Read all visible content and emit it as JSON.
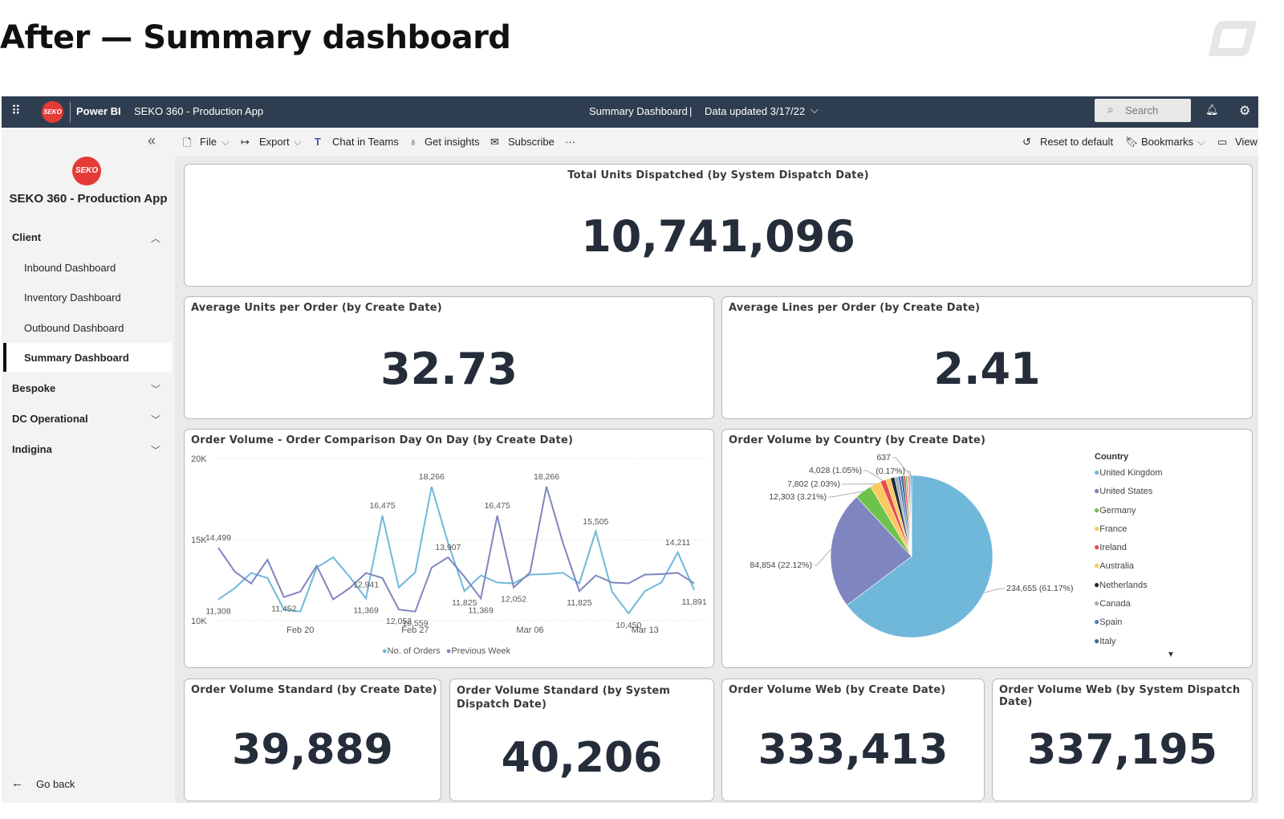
{
  "page_heading": "After — Summary dashboard",
  "topbar": {
    "app_name": "Power BI",
    "workspace": "SEKO 360 - Production App",
    "report_name": "Summary Dashboard",
    "separator": "|",
    "data_updated": "Data updated 3/17/22",
    "search_placeholder": "Search",
    "logo_text": "SEKO"
  },
  "toolbar": {
    "file": "File",
    "export": "Export",
    "chat_in_teams": "Chat in Teams",
    "get_insights": "Get insights",
    "subscribe": "Subscribe",
    "more": "···",
    "reset": "Reset to default",
    "bookmarks": "Bookmarks",
    "view": "View"
  },
  "sidebar": {
    "app_title": "SEKO 360 - Production App",
    "sections": [
      {
        "label": "Client",
        "expanded": true,
        "items": [
          "Inbound Dashboard",
          "Inventory Dashboard",
          "Outbound Dashboard",
          "Summary Dashboard"
        ],
        "active": "Summary Dashboard"
      },
      {
        "label": "Bespoke",
        "expanded": false
      },
      {
        "label": "DC Operational",
        "expanded": false
      },
      {
        "label": "Indigina",
        "expanded": false
      }
    ],
    "go_back": "Go back"
  },
  "cards": {
    "total_units": {
      "title": "Total Units Dispatched (by System Dispatch Date)",
      "value": "10,741,096"
    },
    "avg_units": {
      "title": "Average Units per Order (by Create Date)",
      "value": "32.73"
    },
    "avg_lines": {
      "title": "Average Lines per Order (by Create Date)",
      "value": "2.41"
    },
    "ov_standard_create": {
      "title": "Order Volume Standard (by Create Date)",
      "value": "39,889"
    },
    "ov_standard_dispatch": {
      "title": "Order Volume Standard (by System Dispatch Date)",
      "value": "40,206"
    },
    "ov_web_create": {
      "title": "Order Volume Web (by Create Date)",
      "value": "333,413"
    },
    "ov_web_dispatch": {
      "title": "Order Volume Web (by System Dispatch Date)",
      "value": "337,195"
    }
  },
  "chart_data": [
    {
      "type": "line",
      "title": "Order Volume - Order Comparison Day On Day (by Create Date)",
      "x_start": "2022-02-15",
      "x_ticks": [
        "Feb 20",
        "Feb 27",
        "Mar 06",
        "Mar 13"
      ],
      "y_ticks": [
        "10K",
        "15K",
        "20K"
      ],
      "ylim": [
        10000,
        20000
      ],
      "grid": true,
      "legend": "bottom",
      "series": [
        {
          "name": "No. of Orders",
          "color": "#6fb8da",
          "values": [
            11308,
            12000,
            12941,
            12630,
            10690,
            10559,
            13270,
            13907,
            12710,
            11369,
            16475,
            12052,
            12980,
            18266,
            14800,
            11825,
            12790,
            12350,
            12300,
            12840,
            12870,
            12950,
            12300,
            15505,
            11770,
            10450,
            11825,
            12350,
            14211,
            11891
          ]
        },
        {
          "name": "Previous Week",
          "color": "#7f86bf",
          "values": [
            14499,
            13030,
            12290,
            13760,
            11452,
            11790,
            13390,
            11308,
            12000,
            12941,
            12630,
            10690,
            10559,
            13270,
            13907,
            12710,
            11369,
            16475,
            12052,
            12980,
            18266,
            14800,
            11825,
            12790,
            12350,
            12300,
            12840,
            12870,
            12950,
            12300
          ]
        }
      ],
      "data_labels": [
        {
          "series": 1,
          "index": 0,
          "text": "14,499"
        },
        {
          "series": 0,
          "index": 0,
          "text": "11,308"
        },
        {
          "series": 1,
          "index": 4,
          "text": "11,452"
        },
        {
          "series": 0,
          "index": 9,
          "text": "11,369"
        },
        {
          "series": 1,
          "index": 9,
          "text": "12,941"
        },
        {
          "series": 0,
          "index": 10,
          "text": "16,475"
        },
        {
          "series": 1,
          "index": 11,
          "text": "12,052"
        },
        {
          "series": 1,
          "index": 12,
          "text": "10,559"
        },
        {
          "series": 0,
          "index": 13,
          "text": "18,266"
        },
        {
          "series": 1,
          "index": 14,
          "text": "13,907"
        },
        {
          "series": 0,
          "index": 15,
          "text": "11,825"
        },
        {
          "series": 1,
          "index": 16,
          "text": "11,369"
        },
        {
          "series": 1,
          "index": 17,
          "text": "16,475"
        },
        {
          "series": 1,
          "index": 18,
          "text": "12,052"
        },
        {
          "series": 1,
          "index": 20,
          "text": "18,266"
        },
        {
          "series": 0,
          "index": 23,
          "text": "15,505"
        },
        {
          "series": 1,
          "index": 22,
          "text": "11,825"
        },
        {
          "series": 0,
          "index": 25,
          "text": "10,450"
        },
        {
          "series": 0,
          "index": 28,
          "text": "14,211"
        },
        {
          "series": 0,
          "index": 29,
          "text": "11,891"
        }
      ]
    },
    {
      "type": "pie",
      "title": "Order Volume by Country (by Create Date)",
      "legend_title": "Country",
      "legend": "right",
      "slices": [
        {
          "name": "United Kingdom",
          "value": 234655,
          "label": "234,655 (61.17%)",
          "color": "#6fb8da"
        },
        {
          "name": "United States",
          "value": 84854,
          "label": "84,854 (22.12%)",
          "color": "#7f86bf"
        },
        {
          "name": "Germany",
          "value": 12303,
          "label": "12,303 (3.21%)",
          "color": "#6cc24a"
        },
        {
          "name": "France",
          "value": 7802,
          "label": "7,802 (2.03%)",
          "color": "#fdc85e"
        },
        {
          "name": "Ireland",
          "value": 4028,
          "label": "4,028 (1.05%)",
          "color": "#e84b4b"
        },
        {
          "name": "Australia",
          "value": 3600,
          "label": "",
          "color": "#fdc85e"
        },
        {
          "name": "Netherlands",
          "value": 3000,
          "label": "",
          "color": "#1f2a3a"
        },
        {
          "name": "Canada",
          "value": 2400,
          "label": "",
          "color": "#a6acb8"
        },
        {
          "name": "Spain",
          "value": 2100,
          "label": "",
          "color": "#4f7fb8"
        },
        {
          "name": "Italy",
          "value": 1900,
          "label": "",
          "color": "#3f6a9a"
        },
        {
          "name": "",
          "value": 1500,
          "label": "",
          "color": "#e84b4b"
        },
        {
          "name": "",
          "value": 1200,
          "label": "",
          "color": "#6cc24a"
        },
        {
          "name": "",
          "value": 1000,
          "label": "",
          "color": "#f4a7c0"
        },
        {
          "name": "",
          "value": 900,
          "label": "",
          "color": "#8a5a44"
        },
        {
          "name": "",
          "value": 637,
          "label": "637",
          "color": "#7f86bf"
        },
        {
          "name": "",
          "value": 637,
          "label": "(0.17%)",
          "color": "#2e3e50"
        }
      ]
    }
  ]
}
